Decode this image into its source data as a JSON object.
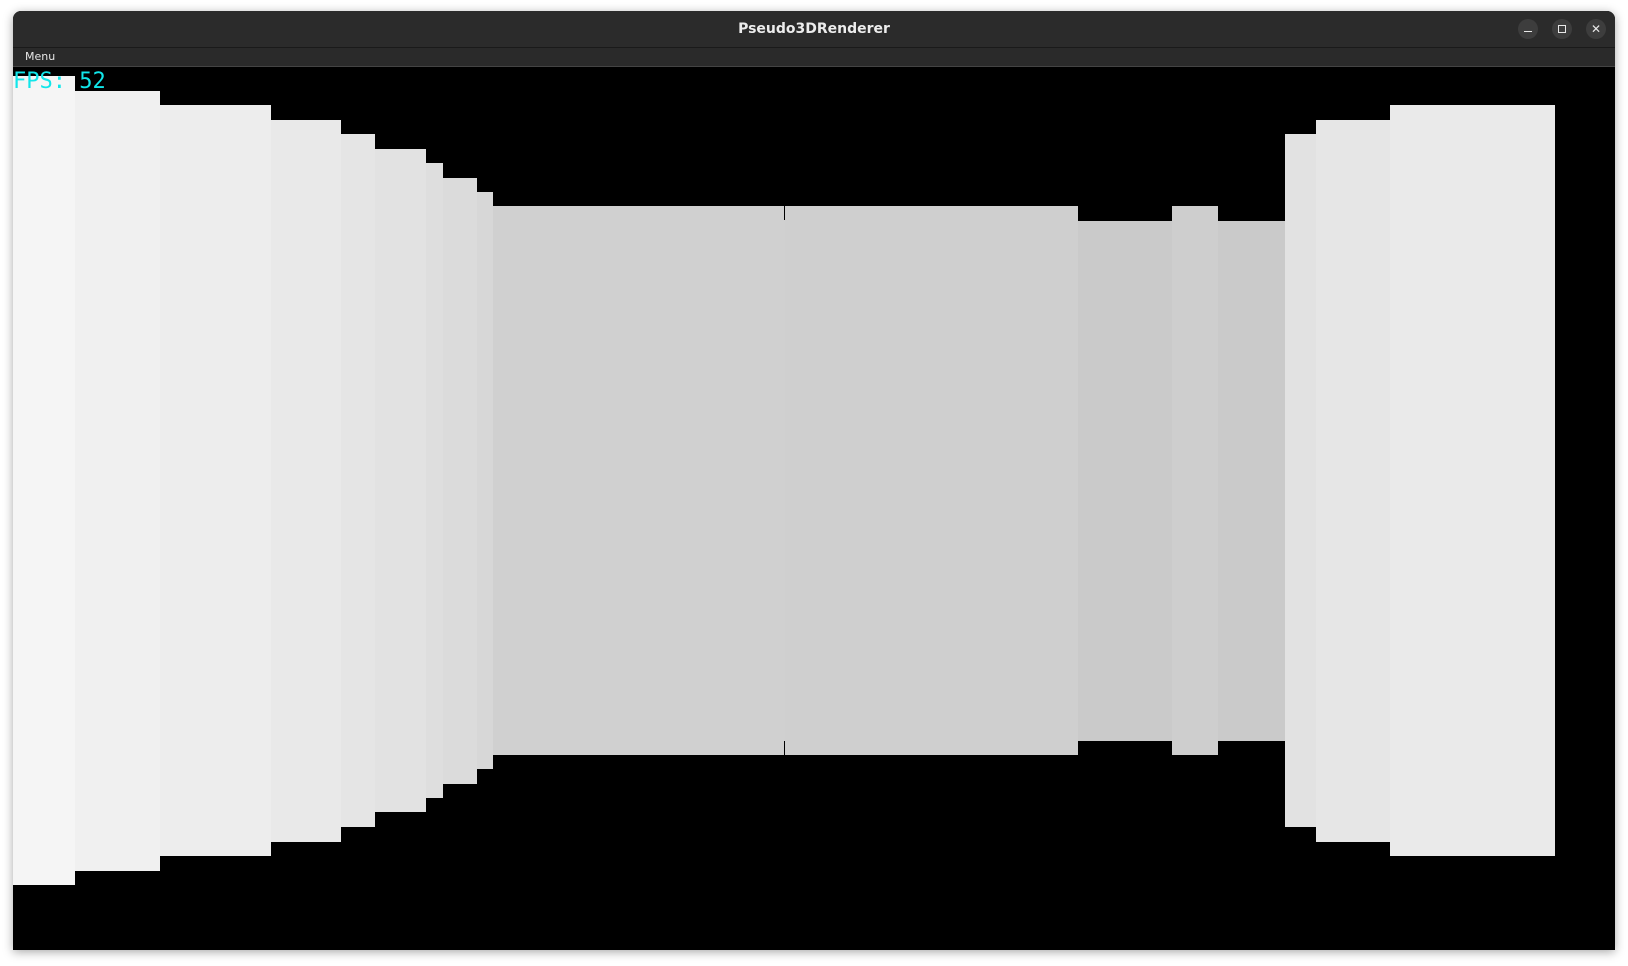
{
  "window": {
    "title": "Pseudo3DRenderer"
  },
  "titlebar_buttons": [
    "minimize-icon",
    "maximize-icon",
    "close-icon"
  ],
  "close_glyph": "✕",
  "menubar": {
    "menu_label": "Menu"
  },
  "hud": {
    "fps_text": "FPS: 52",
    "fps_color": "#11e6ea"
  },
  "scene": {
    "background": "#000000"
  }
}
